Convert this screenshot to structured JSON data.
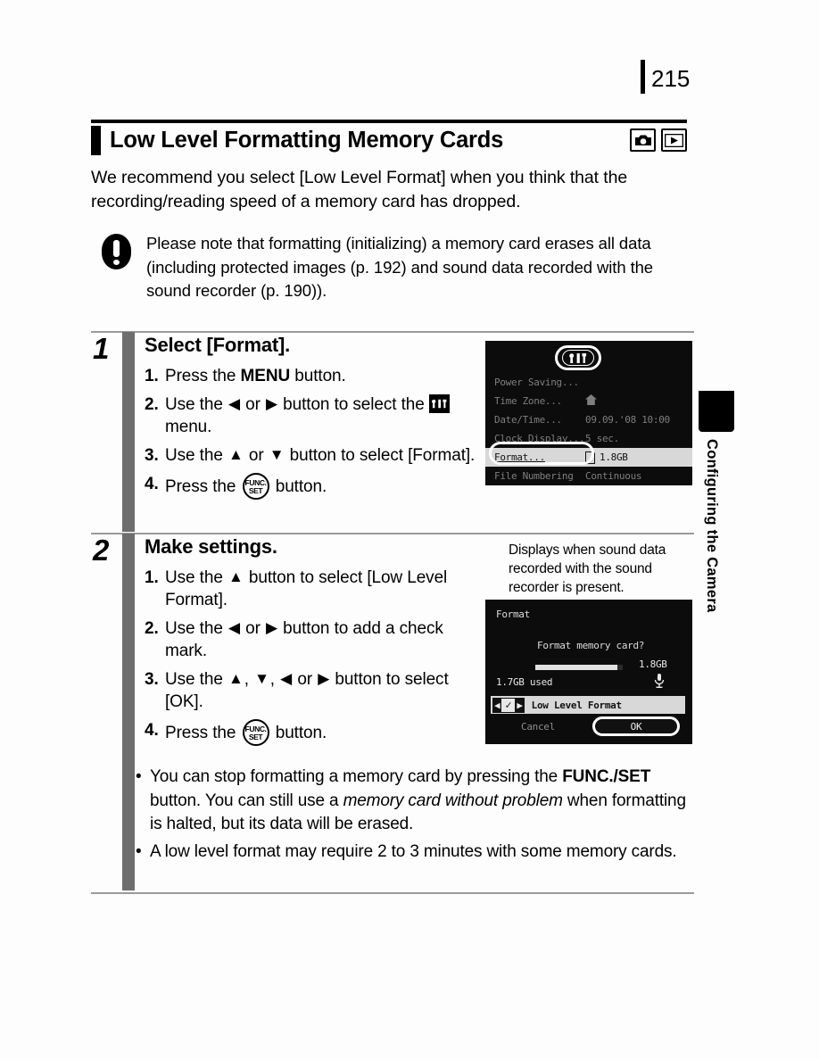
{
  "page": {
    "number": "215",
    "side_tab_label": "Configuring the Camera"
  },
  "header": {
    "title": "Low Level Formatting Memory Cards",
    "mode_icons": [
      "shooting-mode-camera-icon",
      "playback-mode-icon"
    ]
  },
  "intro": {
    "text": "We recommend you select [Low Level Format] when you think that the recording/reading speed of a memory card has dropped."
  },
  "warning": {
    "icon": "exclamation-icon",
    "text": "Please note that formatting (initializing) a memory card erases all data (including protected images (p. 192) and sound data recorded with the sound recorder (p. 190))."
  },
  "steps": [
    {
      "number": "1",
      "title": "Select [Format].",
      "substeps": [
        {
          "n": "1.",
          "parts": [
            {
              "t": "Press the "
            },
            {
              "t": "MENU",
              "b": true
            },
            {
              "t": " button."
            }
          ]
        },
        {
          "n": "2.",
          "parts": [
            {
              "t": "Use the "
            },
            {
              "g": "arrow-left"
            },
            {
              "t": " or "
            },
            {
              "g": "arrow-right"
            },
            {
              "t": " button to select the "
            },
            {
              "g": "tools-menu-icon"
            },
            {
              "t": " menu."
            }
          ]
        },
        {
          "n": "3.",
          "parts": [
            {
              "t": "Use the "
            },
            {
              "g": "arrow-up"
            },
            {
              "t": " or "
            },
            {
              "g": "arrow-down"
            },
            {
              "t": " button to select [Format]."
            }
          ]
        },
        {
          "n": "4.",
          "parts": [
            {
              "t": "Press the "
            },
            {
              "g": "func-set-icon"
            },
            {
              "t": " button."
            }
          ]
        }
      ]
    },
    {
      "number": "2",
      "title": "Make settings.",
      "substeps": [
        {
          "n": "1.",
          "parts": [
            {
              "t": "Use the "
            },
            {
              "g": "arrow-up"
            },
            {
              "t": " button to select [Low Level Format]."
            }
          ]
        },
        {
          "n": "2.",
          "parts": [
            {
              "t": "Use the "
            },
            {
              "g": "arrow-left"
            },
            {
              "t": " or "
            },
            {
              "g": "arrow-right"
            },
            {
              "t": " button to add a check mark."
            }
          ]
        },
        {
          "n": "3.",
          "parts": [
            {
              "t": "Use the "
            },
            {
              "g": "arrow-up"
            },
            {
              "t": ", "
            },
            {
              "g": "arrow-down"
            },
            {
              "t": ", "
            },
            {
              "g": "arrow-left"
            },
            {
              "t": " or "
            },
            {
              "g": "arrow-right"
            },
            {
              "t": " button to select [OK]."
            }
          ]
        },
        {
          "n": "4.",
          "parts": [
            {
              "t": "Press the "
            },
            {
              "g": "func-set-icon"
            },
            {
              "t": " button."
            }
          ]
        }
      ]
    }
  ],
  "caption": {
    "text": "Displays when sound data recorded with the sound recorder is present."
  },
  "lcd_menu": {
    "tab_icon": "tools-menu-icon",
    "rows": [
      {
        "label": "Power Saving...",
        "value": "",
        "state": "faded"
      },
      {
        "label": "Time Zone...",
        "value": "",
        "icon": "home-icon",
        "state": "faded"
      },
      {
        "label": "Date/Time...",
        "value": "09.09.'08 10:00",
        "state": "faded"
      },
      {
        "label": "Clock Display...",
        "value": "5 sec.",
        "state": "faded"
      },
      {
        "label": "Format...",
        "value": "1.8GB",
        "icon": "memory-card-icon",
        "state": "selected"
      },
      {
        "label": "File Numbering",
        "value": "Continuous",
        "state": "faded"
      }
    ]
  },
  "lcd_format_dialog": {
    "title": "Format",
    "question": "Format memory card?",
    "total_size": "1.8GB",
    "used_size": "1.7GB used",
    "sound_icon": "microphone-icon",
    "checkbox_label": "Low Level Format",
    "checkbox_mark": "✓",
    "cancel_label": "Cancel",
    "ok_label": "OK",
    "bar_fill_percent": 94
  },
  "bullets": [
    {
      "parts": [
        {
          "t": "You can stop formatting a memory card by pressing the "
        },
        {
          "t": "FUNC./",
          "b": true
        },
        {
          "t": "SET",
          "b": true
        },
        {
          "t": " button. You can still use a "
        },
        {
          "t": "memory card without problem",
          "i": true
        },
        {
          "t": " when formatting is halted, but its data will be erased."
        }
      ]
    },
    {
      "parts": [
        {
          "t": "A low level format may require 2 to 3 minutes with some memory cards."
        }
      ]
    }
  ],
  "colors": {
    "ink": "#000000",
    "paper": "#fdfdfd",
    "lcd_background": "#0c0c0c",
    "lcd_text": "#e8e8e8",
    "lcd_highlight": "#d8d8d8",
    "step_bar": "#6e6e6e"
  }
}
